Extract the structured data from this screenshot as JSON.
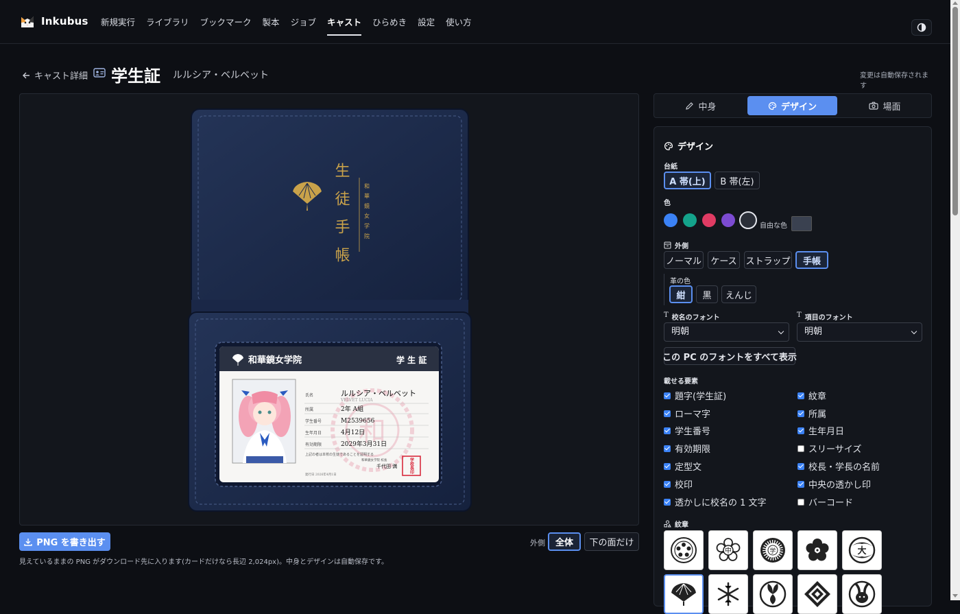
{
  "app": {
    "name": "Inkubus"
  },
  "nav": [
    "新規実行",
    "ライブラリ",
    "ブックマーク",
    "製本",
    "ジョブ",
    "キャスト",
    "ひらめき",
    "設定",
    "使い方"
  ],
  "nav_active": "キャスト",
  "header": {
    "back": "キャスト詳細",
    "title": "学生証",
    "subtitle": "ルルシア・ベルベット",
    "autosave": "変更は自動保存されます"
  },
  "card": {
    "cover_title": "生 徒 手 帳",
    "cover_school": "和 華 鏡 女 学 院",
    "school": "和華鏡女学院",
    "kind": "学 生 証",
    "fields": [
      {
        "label": "氏名",
        "value": "ルルシア・ベルベット"
      },
      {
        "label": "所属",
        "value": "2年 A組"
      },
      {
        "label": "学生番号",
        "value": "M2539656"
      },
      {
        "label": "生年月日",
        "value": "4月12日"
      },
      {
        "label": "有効期限",
        "value": "2029年3月31日"
      }
    ],
    "romaji": "VELVET LUCIA",
    "notice": "上記の者は本校の生徒であることを証明する",
    "principal_title": "和華鏡女学院 校長",
    "principal": "千代田 満",
    "seal": "学校長印",
    "issued": "発行日 2026年4月1日",
    "watermark_char": "和"
  },
  "export": {
    "button": "PNG を書き出す",
    "note": "見えているままの PNG がダウンロード先に入ります(カードだけなら長辺 2,024px)。中身とデザインは自動保存です。"
  },
  "outer_view": {
    "label": "外側",
    "options": [
      "全体",
      "下の面だけ"
    ],
    "selected": "全体"
  },
  "tabs": [
    "中身",
    "デザイン",
    "場面"
  ],
  "tab_active": "デザイン",
  "design": {
    "title": "デザイン",
    "base_label": "台紙",
    "base_options": [
      "A 帯(上)",
      "B 帯(左)"
    ],
    "base_selected": "A 帯(上)",
    "color_label": "色",
    "colors": [
      "#3b82f6",
      "#14a38b",
      "#e03b63",
      "#7c4bd1",
      "#2b2f38"
    ],
    "color_selected": "#2b2f38",
    "free_color_label": "自由な色",
    "free_color": "#3a4150",
    "outer_label": "外側",
    "outer_options": [
      "ノーマル",
      "ケース",
      "ストラップ",
      "手帳"
    ],
    "outer_selected": "手帳",
    "leather_label": "革の色",
    "leather_options": [
      "紺",
      "黒",
      "えんじ"
    ],
    "leather_selected": "紺",
    "school_font_label": "校名のフォント",
    "school_font": "明朝",
    "item_font_label": "項目のフォント",
    "item_font": "明朝",
    "show_fonts_button": "この PC のフォントをすべて表示",
    "elements_label": "載せる要素",
    "elements": [
      {
        "label": "題字(学生証)",
        "checked": true
      },
      {
        "label": "紋章",
        "checked": true
      },
      {
        "label": "ローマ字",
        "checked": true
      },
      {
        "label": "所属",
        "checked": true
      },
      {
        "label": "学生番号",
        "checked": true
      },
      {
        "label": "生年月日",
        "checked": true
      },
      {
        "label": "有効期限",
        "checked": true
      },
      {
        "label": "スリーサイズ",
        "checked": false
      },
      {
        "label": "定型文",
        "checked": true
      },
      {
        "label": "校長・学長の名前",
        "checked": true
      },
      {
        "label": "校印",
        "checked": true
      },
      {
        "label": "中央の透かし印",
        "checked": true
      },
      {
        "label": "透かしに校名の 1 文字",
        "checked": true
      },
      {
        "label": "バーコード",
        "checked": false
      }
    ],
    "crest_label": "紋章",
    "crests": [
      "sakura-ring-crest-icon",
      "sakura-chu-crest-icon",
      "chrysanthemum-gaku-crest-icon",
      "plum-blossom-crest-icon",
      "dai-ring-crest-icon",
      "ginkgo-crest-icon",
      "snowflake-crest-icon",
      "hollyhock-crest-icon",
      "diamond-flower-crest-icon",
      "rabbit-crest-icon"
    ],
    "crest_selected": "ginkgo-crest-icon",
    "crest_chars": {
      "chu": "中",
      "gaku": "学",
      "dai": "大"
    }
  }
}
